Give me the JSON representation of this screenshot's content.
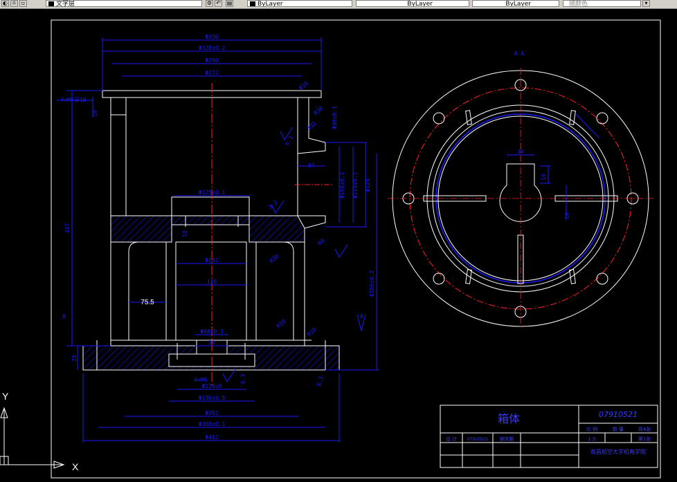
{
  "toolbar": {
    "text_style": "文字层",
    "layer_color": "ByLayer",
    "linetype": "ByLayer",
    "lineweight": "ByLayer",
    "plot_style": "随颜色"
  },
  "section_view": {
    "dims": {
      "d1": "Φ336",
      "d2": "Φ328±0.2",
      "d3": "Φ290",
      "d4": "Φ272",
      "d5": "Φ125±0.1",
      "d6": "Φ142",
      "d7": "116",
      "d8": "Φ68±0.1",
      "d9": "30",
      "d10": "Φ110±0",
      "d11": "Φ136±0.5",
      "d12": "Φ292",
      "d13": "Φ360±0.1",
      "d14": "Φ412",
      "d15": "75.5",
      "d16": "447",
      "d17": "10",
      "d18": "45",
      "d19": "87",
      "d20": "25",
      "d21": "10",
      "d22": "6.3",
      "d23": "4×M6",
      "d24": "Φ108±0.1",
      "d25": "Φ119±0.1",
      "d26": "Φ120",
      "d27": "Φ98±0.1",
      "d28": "4×M6深10",
      "d29": "R30",
      "d30": "R8",
      "d31": "R30",
      "d32": "R10",
      "d33": "R10",
      "d34": "3.2",
      "d35": "6.3",
      "d36": "A",
      "d37": "6.3",
      "d38": "Φ10",
      "d39": "Φ32",
      "d40": "Φ300±0.2"
    }
  },
  "top_view": {
    "label": "A-A",
    "dims": {
      "slot_width": "30",
      "keyway": "10",
      "rib": "10"
    }
  },
  "title_block": {
    "part_name": "箱体",
    "drawing_no": "07910521",
    "designer_label": "设 计",
    "student_id": "07910521",
    "designer_name": "谢庆鹏",
    "scale_label": "比 例",
    "scale": "1:5",
    "qty_label": "数 量",
    "sheet_label": "共4张",
    "sheet_no": "第1张",
    "school": "南昌航空大学机电学院"
  },
  "ucs": {
    "x": "X",
    "y": "Y"
  },
  "colors": {
    "background": "#000000",
    "outline": "#ffffff",
    "dimension": "#1a1aff",
    "centerline": "#ff2020",
    "title_text": "#3a3aff"
  }
}
